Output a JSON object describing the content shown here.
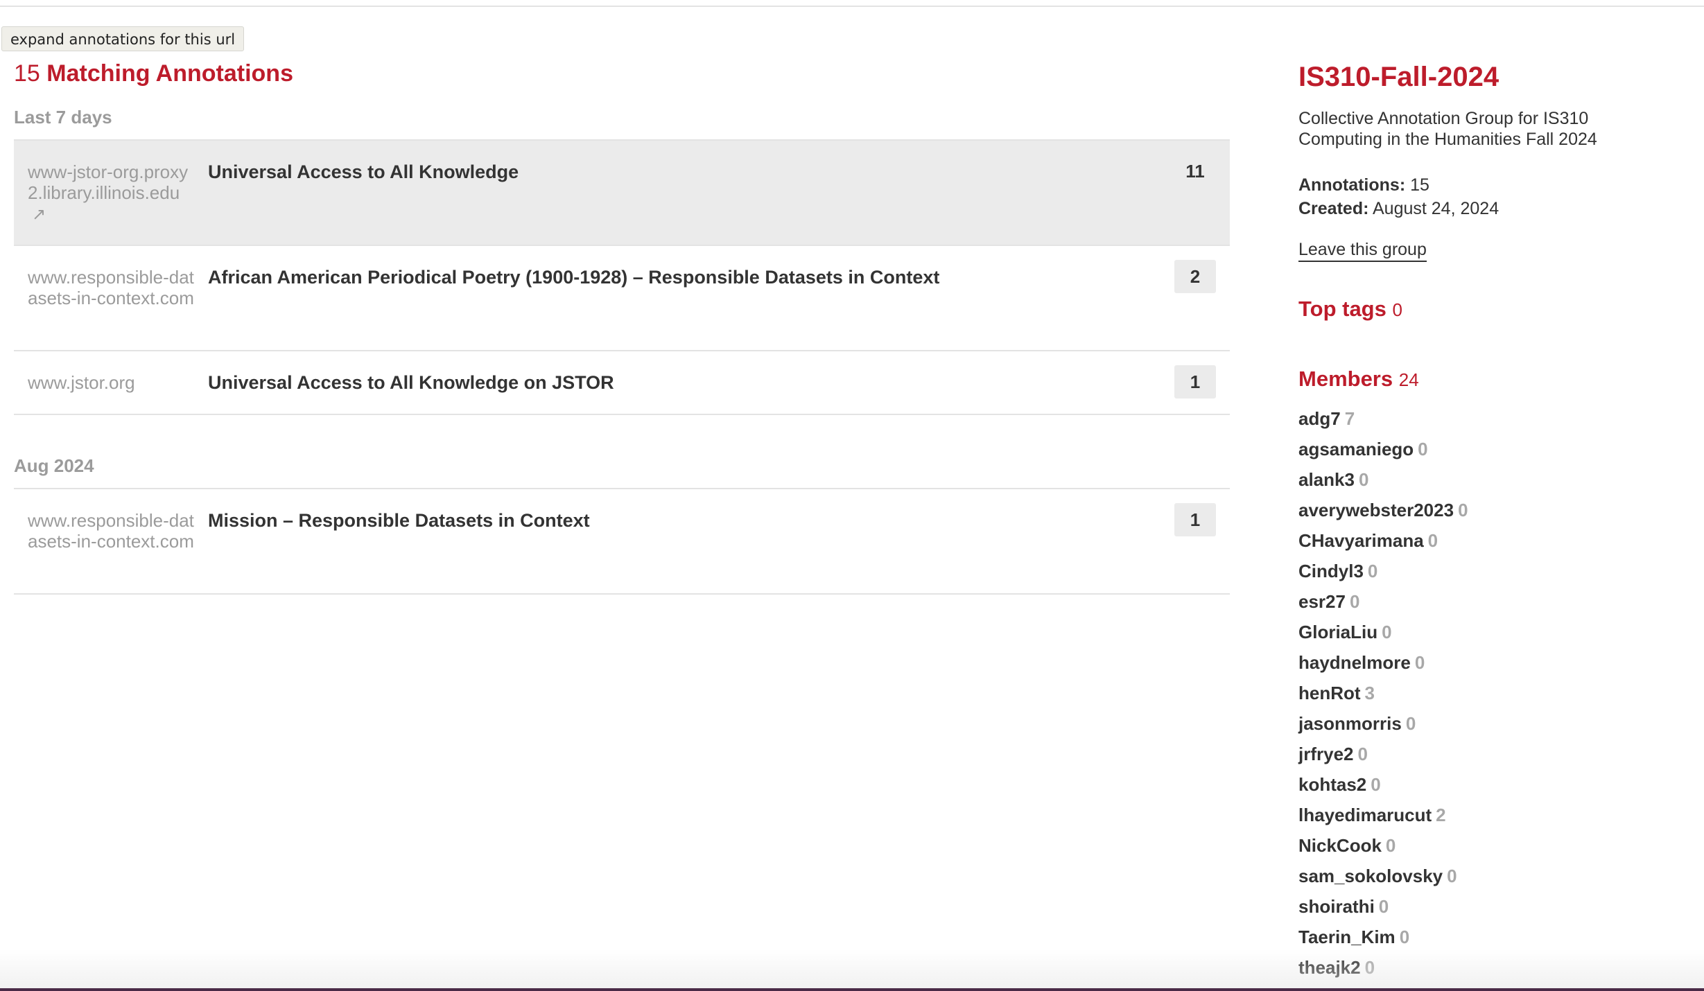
{
  "tooltip": "expand annotations for this url",
  "results": {
    "count": "15",
    "label": "Matching Annotations",
    "groups": [
      {
        "label": "Last 7 days",
        "items": [
          {
            "domain": "www-jstor-org.proxy2.library.illinois.edu",
            "title": "Universal Access to All Knowledge",
            "count": "11"
          },
          {
            "domain": "www.responsible-datasets-in-context.com",
            "title": "African American Periodical Poetry (1900-1928) – Responsible Datasets in Context",
            "count": "2"
          },
          {
            "domain": "www.jstor.org",
            "title": "Universal Access to All Knowledge on JSTOR",
            "count": "1"
          }
        ]
      },
      {
        "label": "Aug 2024",
        "items": [
          {
            "domain": "www.responsible-datasets-in-context.com",
            "title": "Mission – Responsible Datasets in Context",
            "count": "1"
          }
        ]
      }
    ]
  },
  "sidebar": {
    "group_name": "IS310-Fall-2024",
    "description": "Collective Annotation Group for IS310 Computing in the Humanities Fall 2024",
    "annotations_label": "Annotations:",
    "annotations_value": "15",
    "created_label": "Created:",
    "created_value": "August 24, 2024",
    "leave_label": "Leave this group",
    "top_tags_label": "Top tags",
    "top_tags_count": "0",
    "members_label": "Members",
    "members_count": "24",
    "members": [
      {
        "name": "adg7",
        "count": "7"
      },
      {
        "name": "agsamaniego",
        "count": "0"
      },
      {
        "name": "alank3",
        "count": "0"
      },
      {
        "name": "averywebster2023",
        "count": "0"
      },
      {
        "name": "CHavyarimana",
        "count": "0"
      },
      {
        "name": "Cindyl3",
        "count": "0"
      },
      {
        "name": "esr27",
        "count": "0"
      },
      {
        "name": "GloriaLiu",
        "count": "0"
      },
      {
        "name": "haydnelmore",
        "count": "0"
      },
      {
        "name": "henRot",
        "count": "3"
      },
      {
        "name": "jasonmorris",
        "count": "0"
      },
      {
        "name": "jrfrye2",
        "count": "0"
      },
      {
        "name": "kohtas2",
        "count": "0"
      },
      {
        "name": "lhayedimarucut",
        "count": "2"
      },
      {
        "name": "NickCook",
        "count": "0"
      },
      {
        "name": "sam_sokolovsky",
        "count": "0"
      },
      {
        "name": "shoirathi",
        "count": "0"
      },
      {
        "name": "Taerin_Kim",
        "count": "0"
      },
      {
        "name": "theajk2",
        "count": "0"
      }
    ]
  },
  "icons": {
    "external_link": "↗"
  },
  "colors": {
    "accent": "#bd1c2b",
    "muted": "#9b9b9b",
    "highlight_row": "#ebebeb"
  }
}
